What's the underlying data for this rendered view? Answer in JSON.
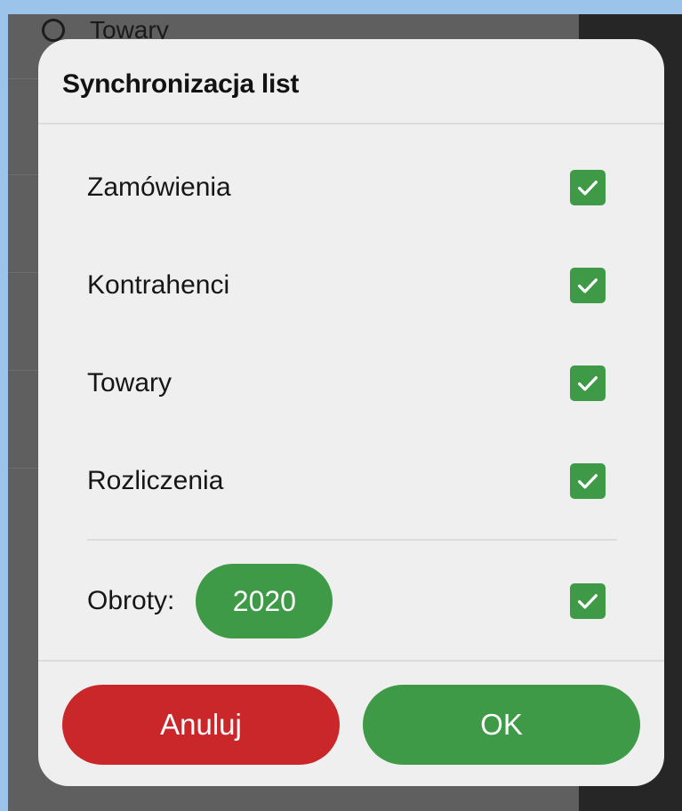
{
  "background": {
    "list_item_label": "Towary"
  },
  "dialog": {
    "title": "Synchronizacja list",
    "options": [
      {
        "label": "Zamówienia",
        "checked": true
      },
      {
        "label": "Kontrahenci",
        "checked": true
      },
      {
        "label": "Towary",
        "checked": true
      },
      {
        "label": "Rozliczenia",
        "checked": true
      }
    ],
    "turnover": {
      "label": "Obroty:",
      "year": "2020",
      "checked": true
    },
    "buttons": {
      "cancel": "Anuluj",
      "ok": "OK"
    }
  },
  "colors": {
    "accent_green": "#3e9a46",
    "cancel_red": "#c9272a",
    "dialog_bg": "#efefef"
  },
  "icons": {
    "checkbox": "check-icon",
    "background_radio": "radio-icon"
  }
}
